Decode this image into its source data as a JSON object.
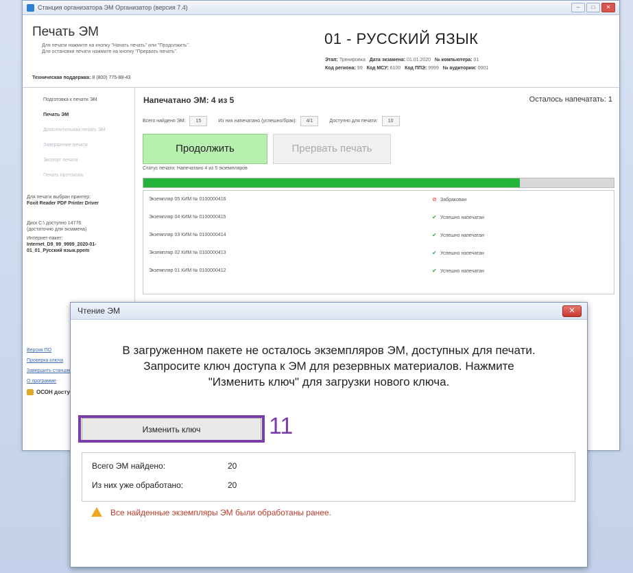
{
  "window": {
    "title": "Станция организатора ЭМ Организатор (версия 7.4)"
  },
  "header": {
    "title": "Печать ЭМ",
    "note_line1": "Для печати нажмите на кнопку \"Начать печать\" или \"Продолжить\".",
    "note_line2": "Для остановки печати нажмите на кнопку \"Прервать печать\".",
    "support_label": "Техническая поддержка:",
    "support_phone": "8 (800) 775-88-43",
    "subject": "01 - РУССКИЙ ЯЗЫК",
    "meta1_label": "Этап:",
    "meta1_value": "Тренировка",
    "meta2_label": "Дата экзамена:",
    "meta2_value": "01.01.2020",
    "meta3_label": "№ компьютера:",
    "meta3_value": "01",
    "meta4_label": "Код региона:",
    "meta4_value": "99",
    "meta5_label": "Код МСУ:",
    "meta5_value": "6100",
    "meta6_label": "Код ППЭ:",
    "meta6_value": "9999",
    "meta7_label": "№ аудитории:",
    "meta7_value": "0001"
  },
  "sidebar": {
    "items": [
      {
        "label": "Подготовка к печати ЭМ"
      },
      {
        "label": "Печать ЭМ"
      },
      {
        "label": "Дополнительная печать ЭМ"
      },
      {
        "label": "Завершение печати"
      },
      {
        "label": "Экспорт печати"
      },
      {
        "label": "Печать протокола"
      }
    ],
    "printer_label": "Для печати выбран принтер:",
    "printer_name": "Foxit Reader PDF Printer Driver",
    "disk_label": "Диск C:\\ доступно 14776",
    "disk_note": "(достаточно для экзамена)",
    "package_label": "Интернет-пакет:",
    "package_name": "Internet_D9_99_9999_2020-01-01_01_Русский язык.ppem",
    "links": [
      "Версия ПО",
      "Проверка ключа",
      "Завершить станцию",
      "О программе"
    ],
    "lock_text": "ОСОН доступен"
  },
  "content": {
    "printed": "Напечатано ЭМ: 4 из 5",
    "remaining": "Осталось напечатать: 1",
    "stat1_label": "Всего найдено ЭМ:",
    "stat1_value": "15",
    "stat2_label": "Из них напечатано (успешно/брак):",
    "stat2_value": "4/1",
    "stat3_label": "Доступно для печати:",
    "stat3_value": "10",
    "continue_label": "Продолжить",
    "interrupt_label": "Прервать печать",
    "status_text": "Статус печати:  Напечатано 4 из 5 экземпляров",
    "progress": 0.8,
    "rows": [
      {
        "name": "Экземпляр 05  КИМ № 0100000416",
        "status": "Забракован",
        "ok": false
      },
      {
        "name": "Экземпляр 04  КИМ № 0100000415",
        "status": "Успешно напечатан",
        "ok": true
      },
      {
        "name": "Экземпляр 03  КИМ № 0100000414",
        "status": "Успешно напечатан",
        "ok": true
      },
      {
        "name": "Экземпляр 02  КИМ № 0100000413",
        "status": "Успешно напечатан",
        "ok": true
      },
      {
        "name": "Экземпляр 01  КИМ № 0100000412",
        "status": "Успешно напечатан",
        "ok": true
      }
    ]
  },
  "dialog": {
    "title": "Чтение ЭМ",
    "msg1": "В загруженном пакете не осталось экземпляров ЭМ, доступных для печати.",
    "msg2": "Запросите ключ доступа к ЭМ для резервных материалов. Нажмите",
    "msg3": "\"Изменить ключ\" для загрузки нового ключа.",
    "change_key_label": "Изменить ключ",
    "step_number": "11",
    "found_label": "Всего ЭМ найдено:",
    "found_value": "20",
    "processed_label": "Из них уже обработано:",
    "processed_value": "20",
    "warning": "Все найденные экземпляры ЭМ были обработаны ранее."
  },
  "colors": {
    "accent_green": "#23b33a",
    "highlight_purple": "#7a3ea8",
    "warning_red": "#c0392b"
  }
}
